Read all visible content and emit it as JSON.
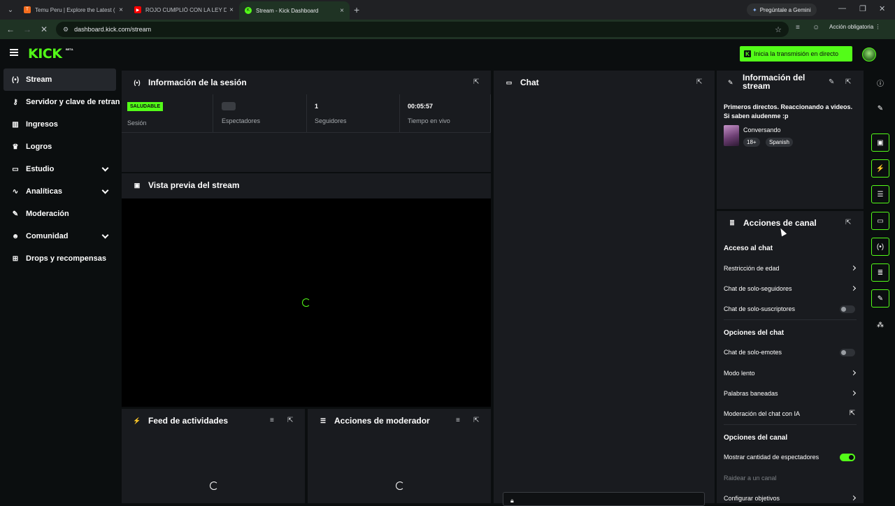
{
  "browser": {
    "tabs": [
      {
        "title": "Temu Peru | Explore the Latest (",
        "fav_color": "#f56d1e",
        "fav_text": "T"
      },
      {
        "title": "ROJO CUMPLIÓ CON LA LEY DE",
        "fav_color": "#ff0000",
        "fav_text": "▶"
      },
      {
        "title": "Stream - Kick Dashboard",
        "fav_color": "#53fc18",
        "fav_text": "K"
      }
    ],
    "new_tab": "+",
    "gemini_label": "Pregúntale a Gemini",
    "url": "dashboard.kick.com/stream",
    "mandatory_action": "Acción obligatoria",
    "minimize": "—",
    "maximize": "❐",
    "close": "✕"
  },
  "header": {
    "logo": "KICK",
    "logo_badge": "BETA",
    "live_button": "Inicia la transmisión en directo"
  },
  "sidebar": {
    "items": [
      {
        "label": "Stream",
        "icon": "(•)"
      },
      {
        "label": "Servidor y clave de retransmisión",
        "icon": "⊘"
      },
      {
        "label": "Ingresos",
        "icon": "▦"
      },
      {
        "label": "Logros",
        "icon": "♛"
      },
      {
        "label": "Estudio",
        "icon": "▭"
      },
      {
        "label": "Analíticas",
        "icon": "∿"
      },
      {
        "label": "Moderación",
        "icon": "✎"
      },
      {
        "label": "Comunidad",
        "icon": "⛭"
      },
      {
        "label": "Drops y recompensas",
        "icon": "⊞"
      }
    ]
  },
  "session": {
    "title": "Información de la sesión",
    "status_badge": "SALUDABLE",
    "status_label": "Sesión",
    "viewers_label": "Espectadores",
    "followers_value": "1",
    "followers_label": "Seguidores",
    "live_time_value": "00:05:57",
    "live_time_label": "Tiempo en vivo"
  },
  "preview": {
    "title": "Vista previa del stream"
  },
  "activity_feed": {
    "title": "Feed de actividades"
  },
  "mod_actions": {
    "title": "Acciones de moderador"
  },
  "chat": {
    "title": "Chat"
  },
  "stream_info": {
    "title_line1": "Información del",
    "title_line2": "stream",
    "stream_title": "Primeros directos. Reaccionando a videos. Si saben aiudenme :p",
    "category": "Conversando",
    "tags": [
      "18+",
      "Spanish"
    ]
  },
  "channel_actions": {
    "title": "Acciones de canal",
    "chat_access": "Acceso al chat",
    "age_restriction": "Restricción de edad",
    "followers_only": "Chat de solo-seguidores",
    "subscribers_only": "Chat de solo-suscriptores",
    "chat_options": "Opciones del chat",
    "emotes_only": "Chat de solo-emotes",
    "slow_mode": "Modo lento",
    "banned_words": "Palabras baneadas",
    "ai_moderation": "Moderación del chat con IA",
    "channel_options": "Opciones del canal",
    "show_viewer_count": "Mostrar cantidad de espectadores",
    "raid_channel": "Raidear a un canal",
    "configure_goals": "Configurar objetivos"
  },
  "colors": {
    "accent": "#53fc18",
    "panel": "#191b1f",
    "background": "#0b0e0f"
  }
}
